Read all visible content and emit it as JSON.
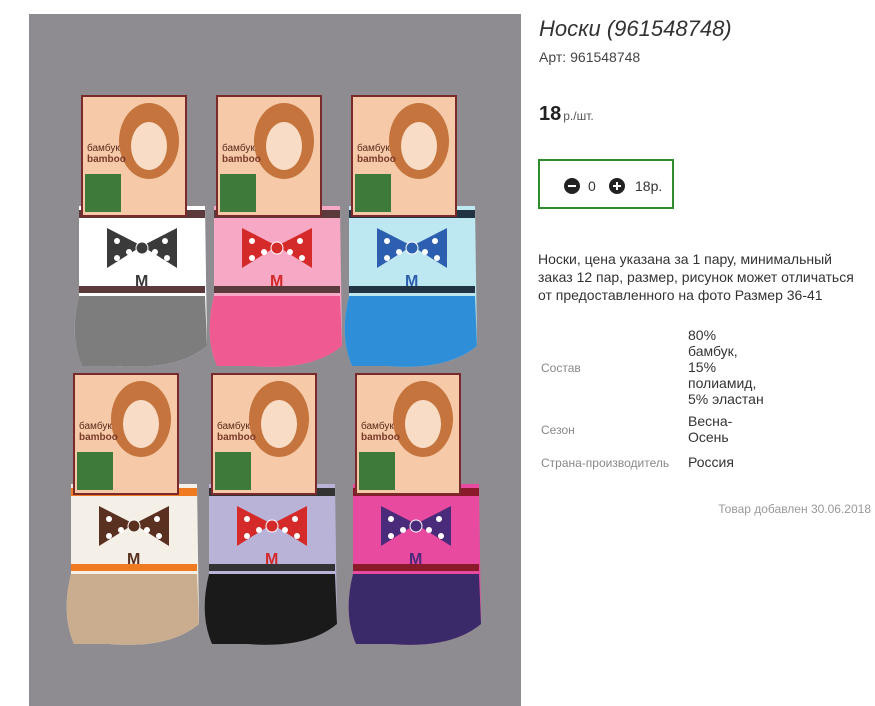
{
  "product": {
    "title": "Носки (961548748)",
    "article_label": "Арт:",
    "article_value": "961548748",
    "price_value": "18",
    "price_unit": "р./шт.",
    "quantity": "0",
    "sum": "18р.",
    "description": "Носки, цена указана за 1 пару, минимальный заказ 12 пар, размер, рисунок может отличаться от предоставленного на фото Размер 36-41",
    "properties": [
      {
        "key": "Состав",
        "value": "80% бамбук, 15% полиамид, 5% эластан"
      },
      {
        "key": "Сезон",
        "value": "Весна-Осень"
      },
      {
        "key": "Страна-производитель",
        "value": "Россия"
      }
    ],
    "added_text": "Товар добавлен 30.06.2018"
  },
  "image": {
    "label_ru": "бамбук",
    "label_en": "bamboo",
    "letter": "M",
    "background_color": "#8e8c91",
    "socks": [
      {
        "body": "#ffffff",
        "toe": "#7d7d7d",
        "bow": "#3a3a3a",
        "stripe": "#5a3a3a"
      },
      {
        "body": "#f7a8c4",
        "toe": "#f05a92",
        "bow": "#d42a2a",
        "stripe": "#5a3a3a"
      },
      {
        "body": "#bde8f2",
        "toe": "#2e8fd8",
        "bow": "#2c5fb0",
        "stripe": "#223344"
      },
      {
        "body": "#f4f0e8",
        "toe": "#c9ad8e",
        "bow": "#5a3020",
        "stripe": "#f07a20"
      },
      {
        "body": "#b9b3d8",
        "toe": "#1a1a1a",
        "bow": "#d42a2a",
        "stripe": "#333333"
      },
      {
        "body": "#e84aa0",
        "toe": "#3a2a6a",
        "bow": "#4a2a7a",
        "stripe": "#8a1a2a"
      }
    ]
  }
}
